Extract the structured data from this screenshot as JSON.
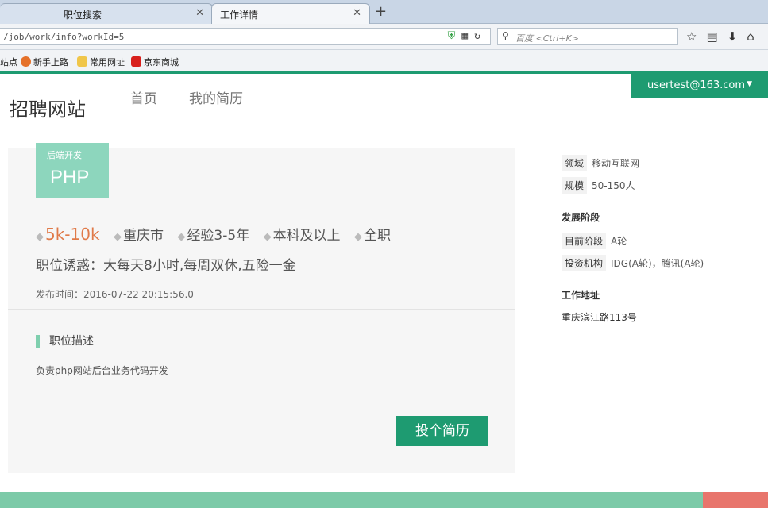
{
  "browser": {
    "tabs": [
      {
        "label": "职位搜索"
      },
      {
        "label": "工作详情"
      }
    ],
    "url": "/job/work/info?workId=5",
    "search_placeholder": "百度 <Ctrl+K>",
    "bookmarks": [
      "站点",
      "新手上路",
      "常用网址",
      "京东商城"
    ]
  },
  "header": {
    "brand": "招聘网站",
    "nav": [
      "首页",
      "我的简历"
    ],
    "user": "usertest@163.com"
  },
  "job": {
    "category": "后端开发",
    "title": "PHP",
    "salary": "5k-10k",
    "city": "重庆市",
    "experience": "经验3-5年",
    "education": "本科及以上",
    "type": "全职",
    "perk": "职位诱惑：大每天8小时,每周双休,五险一金",
    "published": "发布时间：2016-07-22 20:15:56.0",
    "desc_title": "职位描述",
    "desc": "负责php网站后台业务代码开发",
    "apply_label": "投个简历"
  },
  "company": {
    "field_label": "领域",
    "field": "移动互联网",
    "size_label": "规模",
    "size": "50-150人",
    "stage_title": "发展阶段",
    "current_label": "目前阶段",
    "current": "A轮",
    "investor_label": "投资机构",
    "investor": "IDG(A轮)，腾讯(A轮)",
    "address_title": "工作地址",
    "address": "重庆滨江路113号"
  },
  "colors": {
    "accent": "#1e9b71",
    "tag_bg": "#8dd6bd",
    "salary": "#e07a49"
  }
}
